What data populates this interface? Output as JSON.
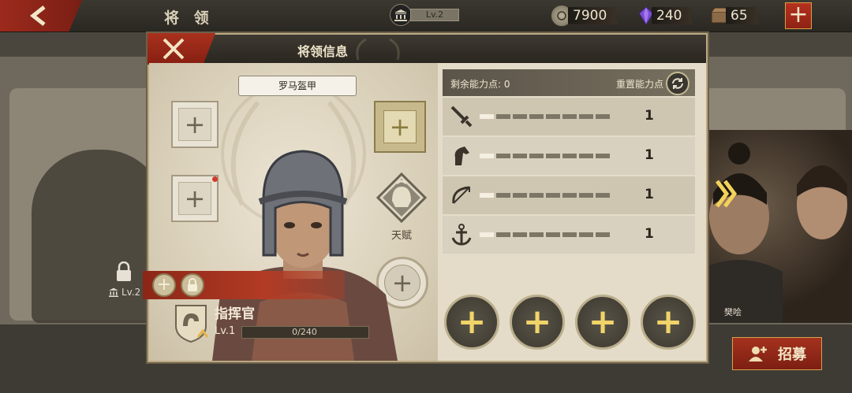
{
  "topbar": {
    "title": "将 领",
    "level": "Lv.2",
    "resources": [
      {
        "name": "coin",
        "icon": "coin-icon",
        "value": "7900"
      },
      {
        "name": "gem",
        "icon": "gem-icon",
        "value": "240"
      },
      {
        "name": "crate",
        "icon": "crate-icon",
        "value": "65"
      }
    ],
    "add_label": "+"
  },
  "background": {
    "locked_level": "Lv.2",
    "right_general_name": "樊哙"
  },
  "recruit_button": {
    "label": "招募"
  },
  "panel": {
    "title": "将领信息",
    "equipment_label": "罗马盔甲",
    "talent_label": "天赋",
    "general": {
      "rank": "指挥官",
      "level": "Lv.1",
      "xp": "0/240",
      "xp_fraction": 0.0
    },
    "points": {
      "remaining_label": "剩余能力点: 0",
      "reset_label": "重置能力点"
    },
    "stats": [
      {
        "icon": "sword-icon",
        "value": "1",
        "filled": 1,
        "total": 8
      },
      {
        "icon": "horse-icon",
        "value": "1",
        "filled": 1,
        "total": 8
      },
      {
        "icon": "bow-icon",
        "value": "1",
        "filled": 1,
        "total": 8
      },
      {
        "icon": "anchor-icon",
        "value": "1",
        "filled": 1,
        "total": 8
      }
    ],
    "add_slots": [
      "+",
      "+",
      "+",
      "+"
    ]
  },
  "colors": {
    "accent_red": "#a9311e",
    "gold": "#f0d46a",
    "panel_bg": "#e4dcc9"
  }
}
